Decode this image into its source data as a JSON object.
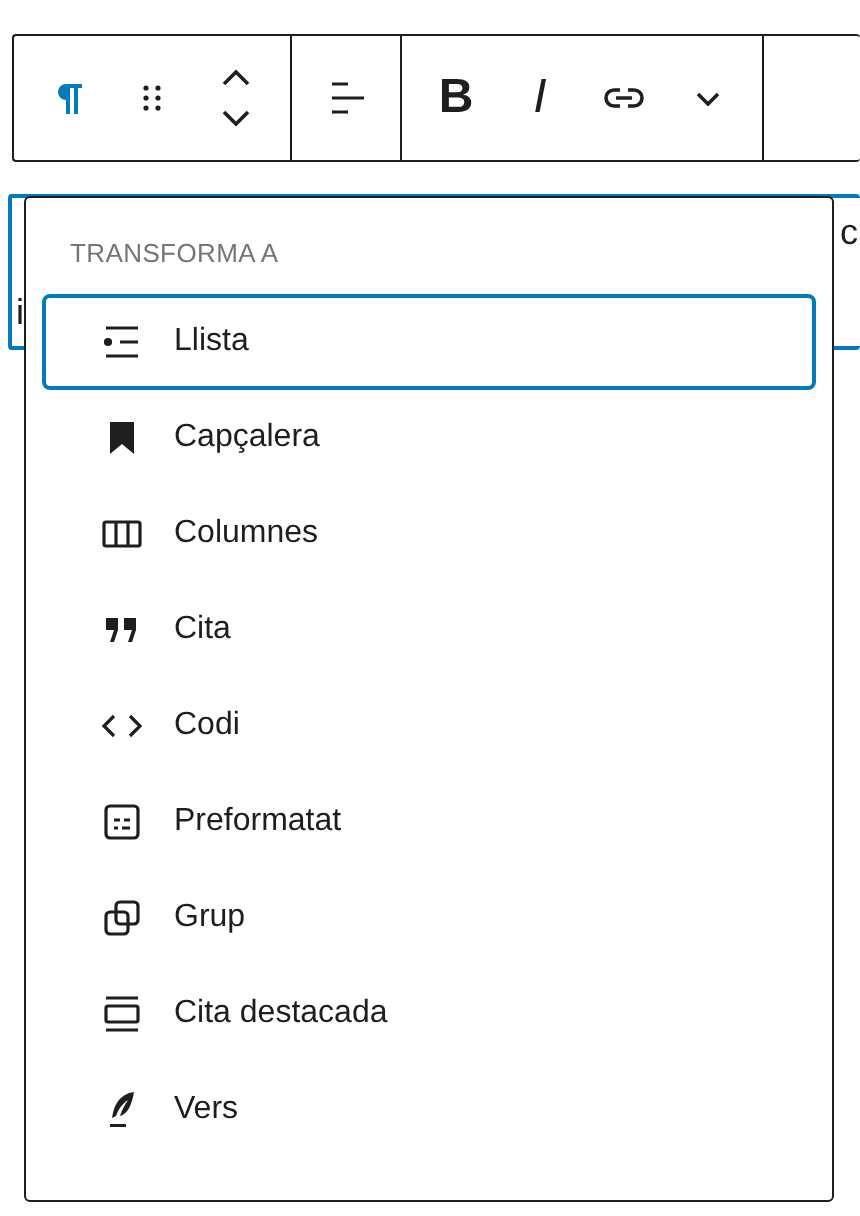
{
  "toolbar": {
    "groups": [
      {
        "buttons": [
          {
            "kind": "paragraph",
            "active": true
          },
          {
            "kind": "drag"
          },
          {
            "kind": "movers"
          }
        ]
      },
      {
        "buttons": [
          {
            "kind": "align"
          }
        ]
      },
      {
        "buttons": [
          {
            "kind": "bold",
            "label": "B"
          },
          {
            "kind": "italic",
            "label": "I"
          },
          {
            "kind": "link"
          },
          {
            "kind": "more"
          }
        ]
      }
    ]
  },
  "paragraph": {
    "line_1_end": "c",
    "line_2_start": "i"
  },
  "menu": {
    "heading": "TRANSFORMA A",
    "items": [
      {
        "kind": "list",
        "label": "Llista",
        "selected": true
      },
      {
        "kind": "heading",
        "label": "Capçalera",
        "selected": false
      },
      {
        "kind": "columns",
        "label": "Columnes",
        "selected": false
      },
      {
        "kind": "quote",
        "label": "Cita",
        "selected": false
      },
      {
        "kind": "code",
        "label": "Codi",
        "selected": false
      },
      {
        "kind": "preformatted",
        "label": "Preformatat",
        "selected": false
      },
      {
        "kind": "group",
        "label": "Grup",
        "selected": false
      },
      {
        "kind": "pullquote",
        "label": "Cita destacada",
        "selected": false
      },
      {
        "kind": "verse",
        "label": "Vers",
        "selected": false
      }
    ]
  }
}
